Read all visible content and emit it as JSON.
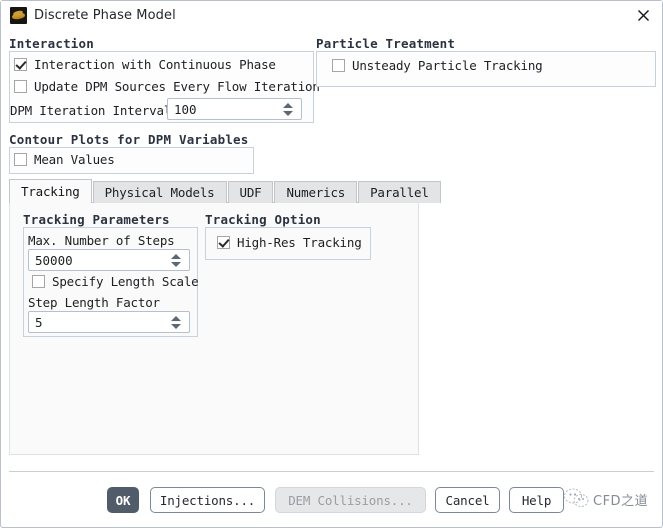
{
  "window": {
    "title": "Discrete Phase Model",
    "icon": "fluent-app-icon",
    "close_label": "✕"
  },
  "interaction": {
    "caption": "Interaction",
    "checkboxes": [
      {
        "label": "Interaction with Continuous Phase",
        "checked": true
      },
      {
        "label": "Update DPM Sources Every Flow Iteration",
        "checked": false
      }
    ],
    "interval": {
      "label": "DPM Iteration Interval",
      "value": "100"
    }
  },
  "particle_treatment": {
    "caption": "Particle Treatment",
    "checkboxes": [
      {
        "label": "Unsteady Particle Tracking",
        "checked": false
      }
    ]
  },
  "contour_plots": {
    "caption": "Contour Plots for DPM Variables",
    "checkboxes": [
      {
        "label": "Mean Values",
        "checked": false
      }
    ]
  },
  "tabs": [
    {
      "label": "Tracking",
      "active": true
    },
    {
      "label": "Physical Models",
      "active": false
    },
    {
      "label": "UDF",
      "active": false
    },
    {
      "label": "Numerics",
      "active": false
    },
    {
      "label": "Parallel",
      "active": false
    }
  ],
  "tracking_parameters": {
    "caption": "Tracking Parameters",
    "max_steps": {
      "label": "Max. Number of Steps",
      "value": "50000"
    },
    "specify_length_scale": {
      "label": "Specify Length Scale",
      "checked": false
    },
    "step_length_factor": {
      "label": "Step Length Factor",
      "value": "5"
    }
  },
  "tracking_option": {
    "caption": "Tracking Option",
    "checkboxes": [
      {
        "label": "High-Res Tracking",
        "checked": true
      }
    ]
  },
  "footer": {
    "ok": "OK",
    "injections": "Injections...",
    "dem_collisions": "DEM Collisions...",
    "cancel": "Cancel",
    "help": "Help"
  },
  "watermark": {
    "text": "CFD之道",
    "icon": "wechat-logo-icon"
  },
  "colors": {
    "accent": "#515c6b",
    "group_border": "#c8d2dd",
    "panel_bg": "#fafafa",
    "caption": "#2c3340"
  }
}
